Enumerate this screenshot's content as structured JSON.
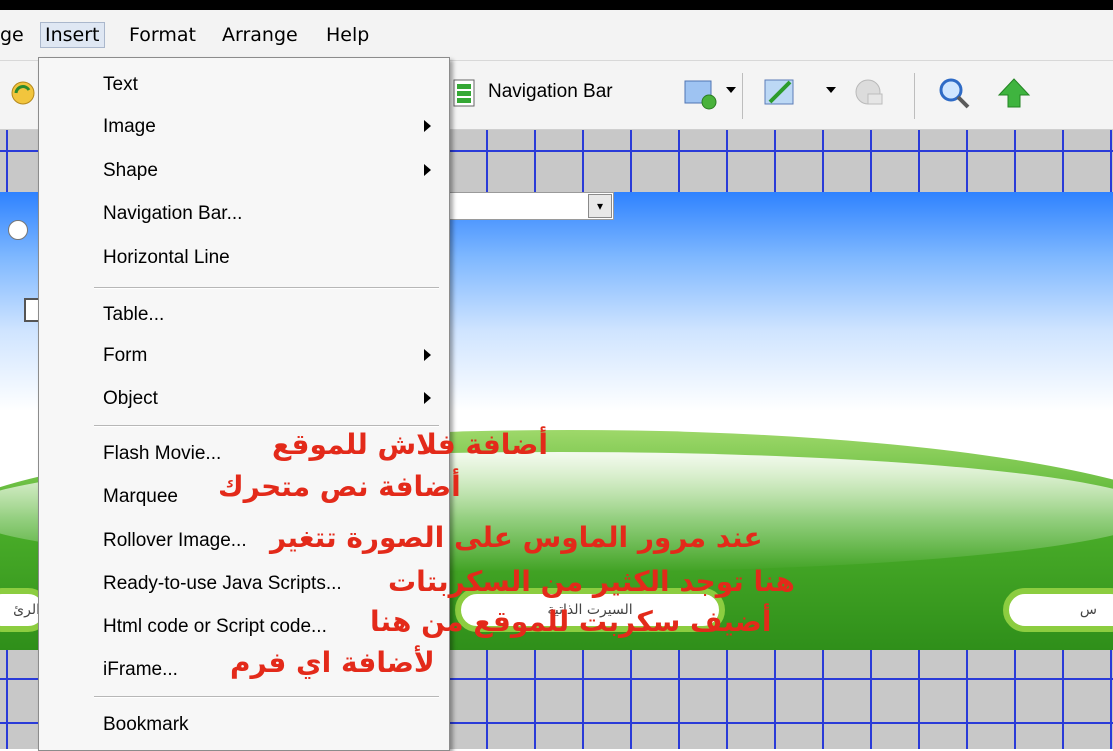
{
  "menubar": {
    "partial_left": "ge",
    "items": [
      "Insert",
      "Format",
      "Arrange",
      "Help"
    ],
    "active": "Insert"
  },
  "toolbar": {
    "navigation_bar_label": "Navigation Bar"
  },
  "insert_menu": {
    "items": [
      {
        "label": "Text",
        "submenu": false
      },
      {
        "label": "Image",
        "submenu": true
      },
      {
        "label": "Shape",
        "submenu": true
      },
      {
        "label": "Navigation Bar...",
        "submenu": false
      },
      {
        "label": "Horizontal Line",
        "submenu": false
      },
      {
        "label": "Table...",
        "submenu": false
      },
      {
        "label": "Form",
        "submenu": true
      },
      {
        "label": "Object",
        "submenu": true
      },
      {
        "label": "Flash Movie...",
        "submenu": false
      },
      {
        "label": "Marquee",
        "submenu": false
      },
      {
        "label": "Rollover Image...",
        "submenu": false
      },
      {
        "label": "Ready-to-use Java Scripts...",
        "submenu": false
      },
      {
        "label": "Html code or Script code...",
        "submenu": false
      },
      {
        "label": "iFrame...",
        "submenu": false
      },
      {
        "label": "Bookmark",
        "submenu": false
      }
    ]
  },
  "annotations": {
    "flash": "أضافة فلاش للموقع",
    "marquee": "أضافة نص متحرك",
    "rollover": "عند مرور الماوس على الصورة تتغير",
    "scripts": "هنا توجد الكثير من السكربتات",
    "html": "أضيف سكربت للموقع من هنا",
    "iframe": "لأضافة اي فرم"
  },
  "canvas": {
    "pill_left_text": "الرئ",
    "pill_mid_text": "السيرت الذاتية",
    "pill_right_text": "س"
  },
  "colors": {
    "grid": "#2a3bd8",
    "annotation": "#e32a1a",
    "pill_border": "#8ccd40"
  }
}
